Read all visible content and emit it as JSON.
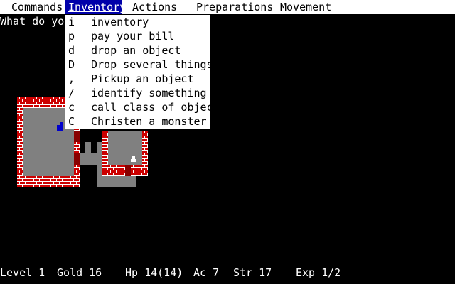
{
  "menubar": {
    "items": [
      {
        "label": "Commands"
      },
      {
        "label": "Inventory"
      },
      {
        "label": "Actions"
      },
      {
        "label": "Preparations"
      },
      {
        "label": "Movement"
      }
    ],
    "active": "Inventory"
  },
  "prompt": "What do you",
  "dropdown": {
    "items": [
      {
        "key": "i",
        "label": "inventory"
      },
      {
        "key": "p",
        "label": "pay your bill"
      },
      {
        "key": "d",
        "label": "drop an object"
      },
      {
        "key": "D",
        "label": "Drop several things"
      },
      {
        "key": ",",
        "label": "Pickup an object"
      },
      {
        "key": "/",
        "label": "identify something"
      },
      {
        "key": "c",
        "label": "call class of objects"
      },
      {
        "key": "C",
        "label": "Christen a monster"
      }
    ]
  },
  "map": {
    "wall_color": "#cc0000",
    "floor_color": "#808080",
    "door_color": "#880000",
    "player_color": "#0000cc",
    "player_icon": "player-sprite-icon",
    "monster_icon": "dog-sprite-icon"
  },
  "status": {
    "level": "Level 1",
    "gold": "Gold 16",
    "hp": "Hp  14(14)",
    "ac": "Ac 7",
    "str": "Str 17",
    "exp": "Exp  1/2"
  }
}
